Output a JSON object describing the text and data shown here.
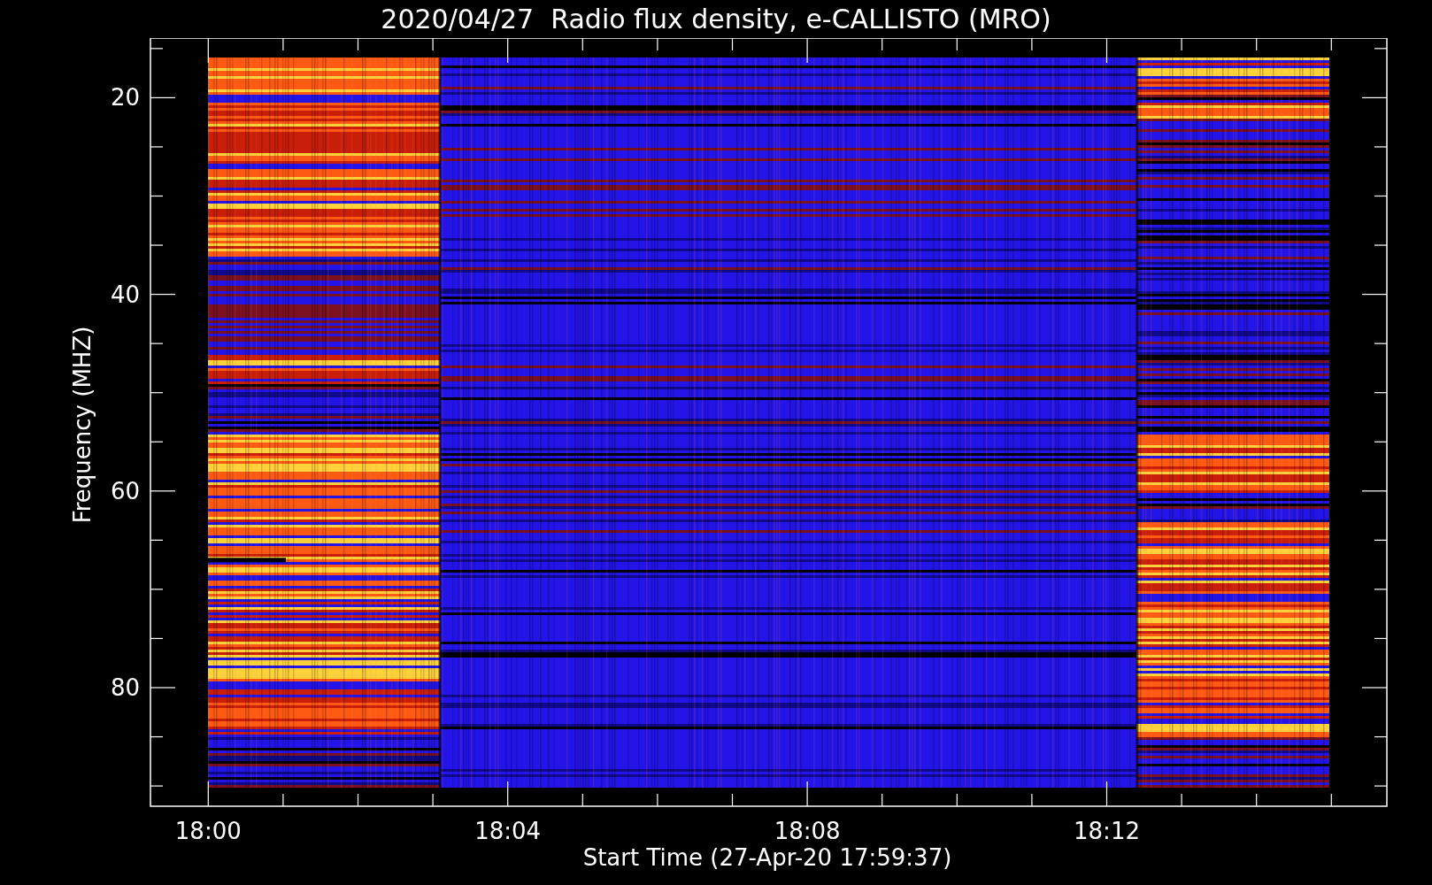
{
  "title": "2020/04/27  Radio flux density, e-CALLISTO (MRO)",
  "plot": {
    "ylabel": "Frequency (MHZ)",
    "xlabel": "Start Time (27-Apr-20 17:59:37)",
    "yticks": [
      "20",
      "40",
      "60",
      "80"
    ],
    "xticks": [
      "18:00",
      "18:04",
      "18:08",
      "18:12"
    ]
  }
}
